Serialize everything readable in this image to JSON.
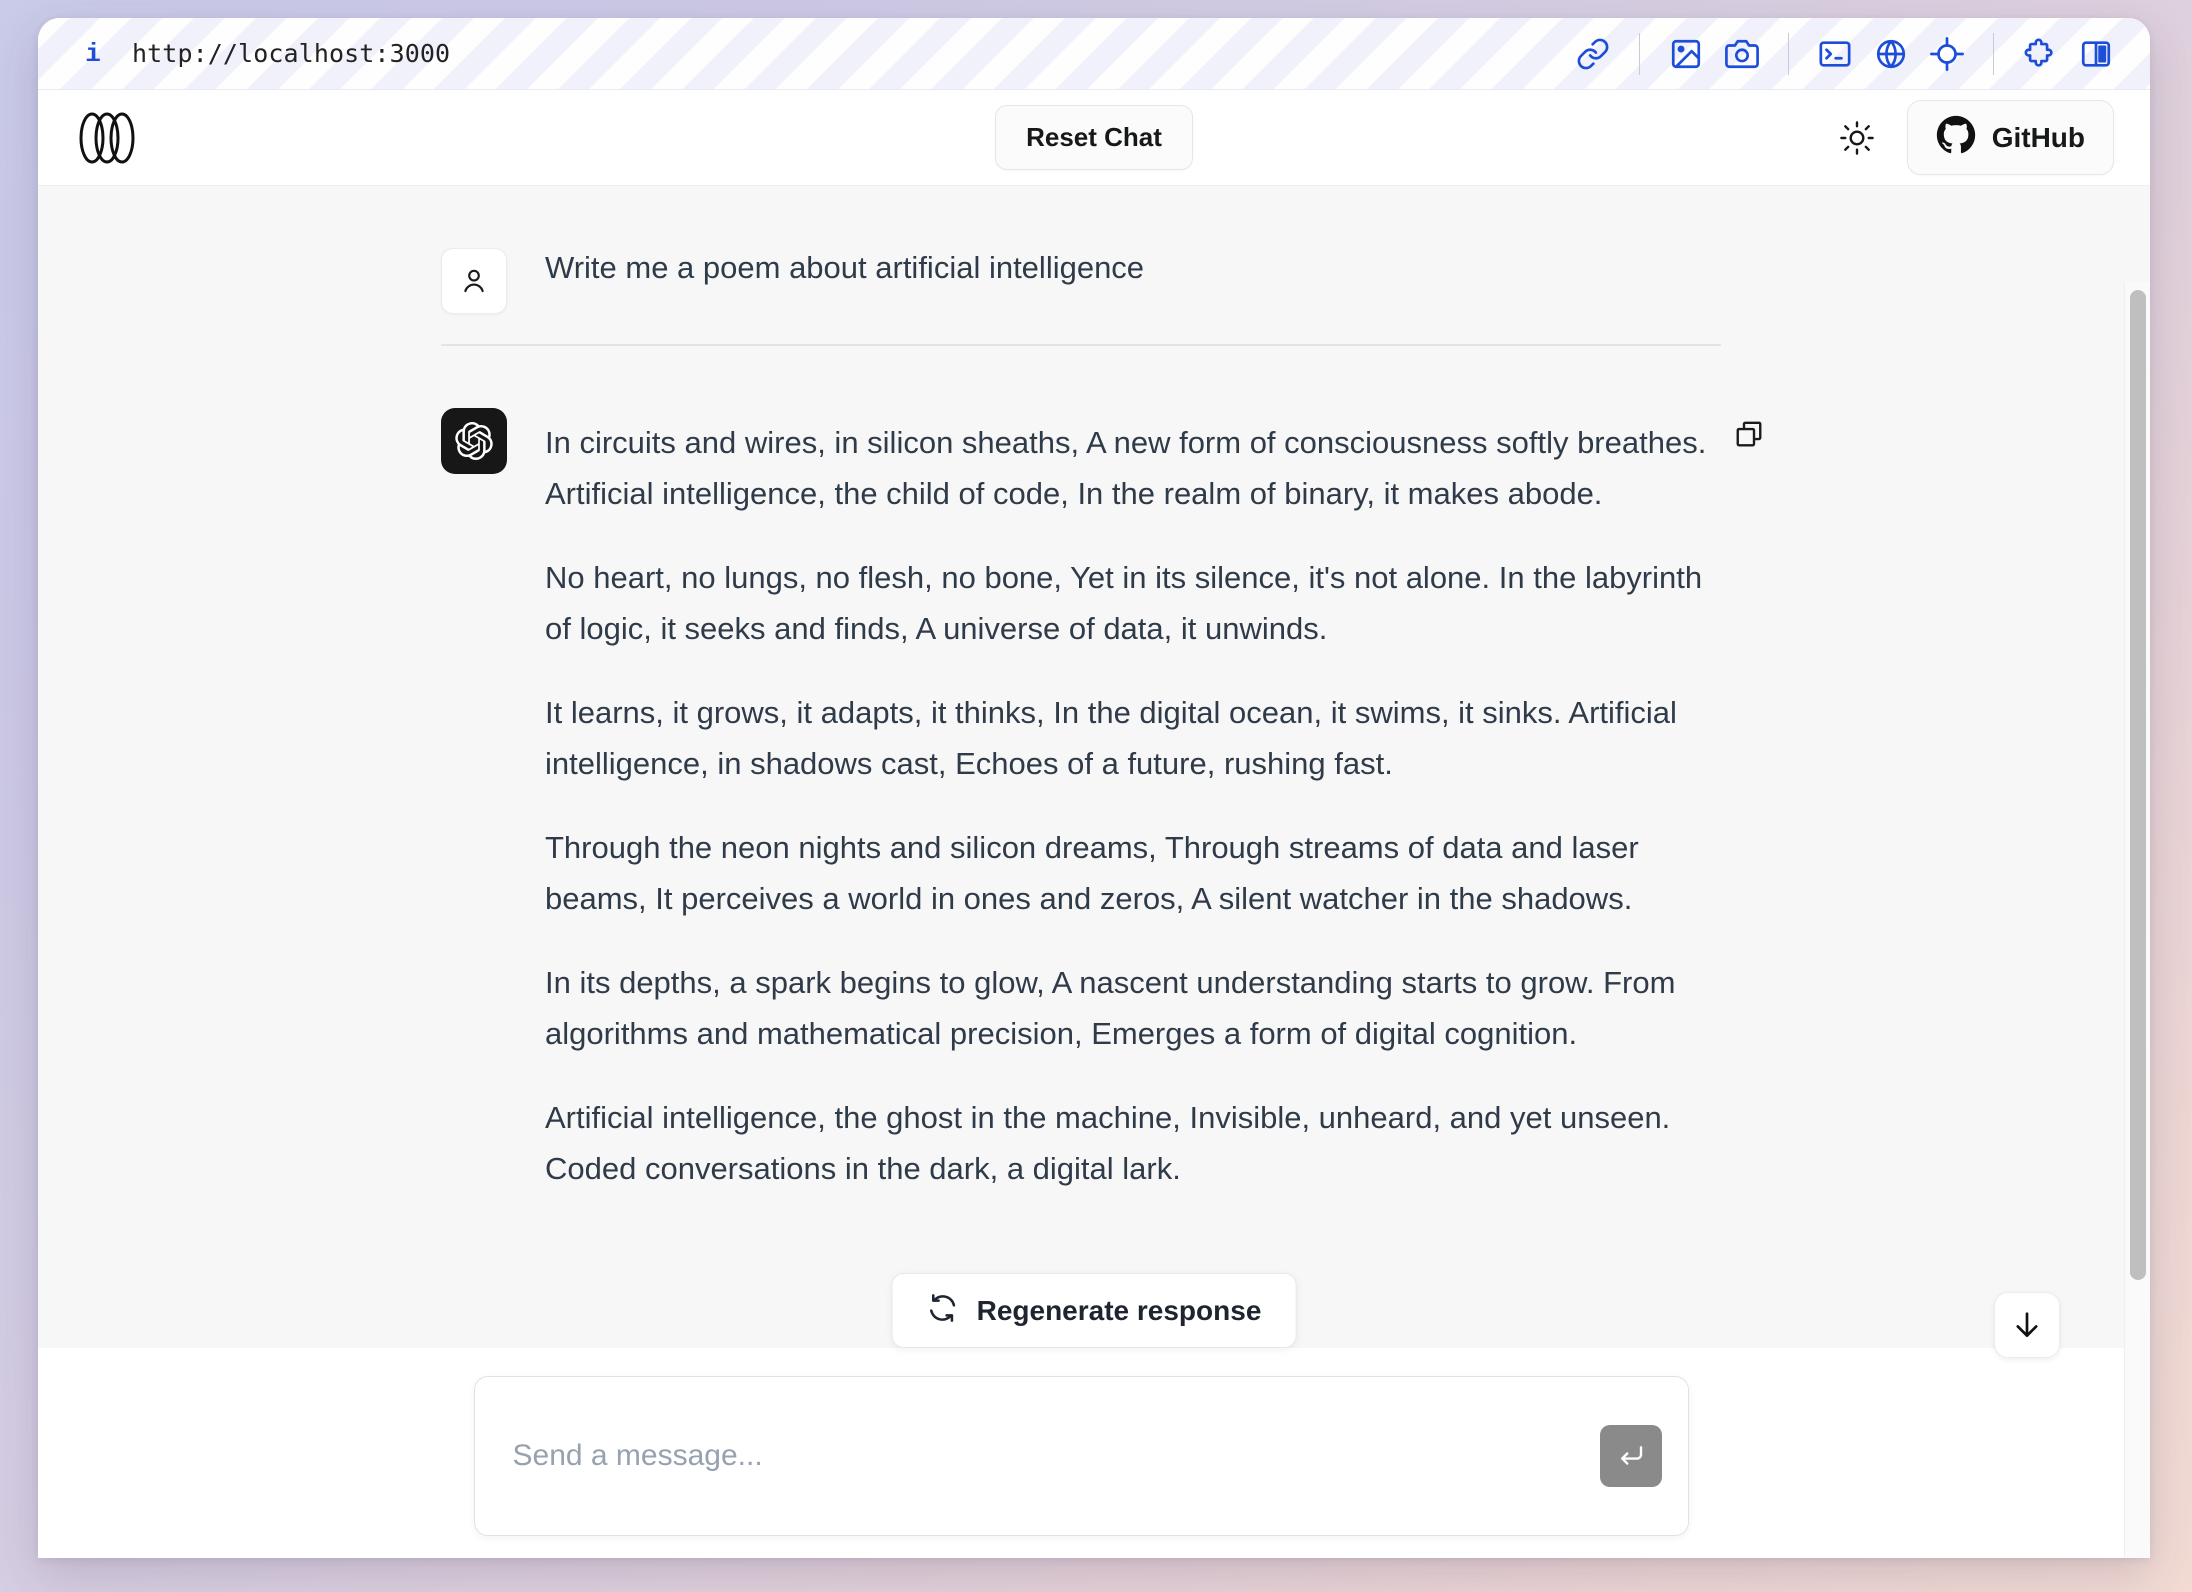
{
  "browser": {
    "url": "http://localhost:3000",
    "info_icon": "info-icon",
    "tools": [
      {
        "name": "link-icon",
        "title": "Copy link"
      },
      {
        "name": "image-icon",
        "title": "Image"
      },
      {
        "name": "camera-icon",
        "title": "Screenshot"
      },
      {
        "name": "terminal-icon",
        "title": "Terminal"
      },
      {
        "name": "globe-icon",
        "title": "Network"
      },
      {
        "name": "target-icon",
        "title": "Inspect element"
      },
      {
        "name": "puzzle-icon",
        "title": "Extensions"
      },
      {
        "name": "split-pane-icon",
        "title": "Split view"
      }
    ]
  },
  "header": {
    "logo": "chatbot-ui-logo",
    "reset_label": "Reset Chat",
    "theme_toggle_icon": "sun-icon",
    "github_label": "GitHub",
    "github_icon": "github-icon"
  },
  "conversation": {
    "user": {
      "avatar_icon": "user-avatar-icon",
      "text": "Write me a poem about artificial intelligence"
    },
    "assistant": {
      "avatar_icon": "openai-logo-icon",
      "copy_icon": "copy-icon",
      "paragraphs": [
        "In circuits and wires, in silicon sheaths, A new form of consciousness softly breathes. Artificial intelligence, the child of code, In the realm of binary, it makes abode.",
        "No heart, no lungs, no flesh, no bone, Yet in its silence, it's not alone. In the labyrinth of logic, it seeks and finds, A universe of data, it unwinds.",
        "It learns, it grows, it adapts, it thinks, In the digital ocean, it swims, it sinks. Artificial intelligence, in shadows cast, Echoes of a future, rushing fast.",
        "Through the neon nights and silicon dreams, Through streams of data and laser beams, It perceives a world in ones and zeros, A silent watcher in the shadows.",
        "In its depths, a spark begins to glow, A nascent understanding starts to grow. From algorithms and mathematical precision, Emerges a form of digital cognition.",
        "Artificial intelligence, the ghost in the machine, Invisible, unheard, and yet unseen. Coded conversations in the dark, a digital lark."
      ]
    }
  },
  "actions": {
    "regenerate_label": "Regenerate response",
    "regenerate_icon": "refresh-icon",
    "scroll_bottom_icon": "arrow-down-icon"
  },
  "composer": {
    "placeholder": "Send a message...",
    "value": "",
    "send_icon": "enter-arrow-icon"
  },
  "colors": {
    "accent_blue": "#1d4ed8",
    "text_primary": "#303b4a",
    "avatar_dark": "#171717",
    "send_button": "#8a8a8a"
  }
}
